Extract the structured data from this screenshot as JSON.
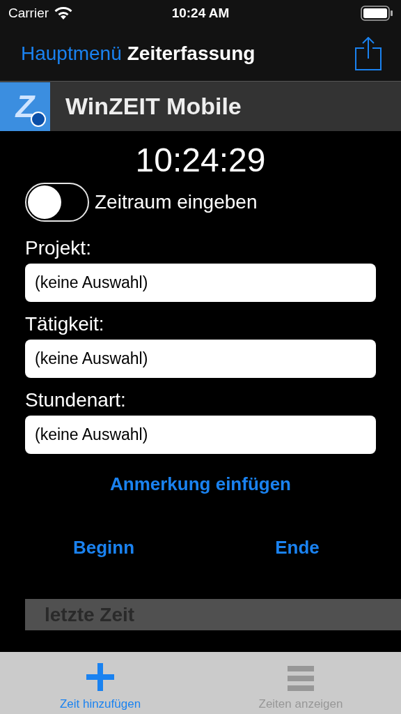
{
  "status_bar": {
    "carrier": "Carrier",
    "time": "10:24 AM"
  },
  "nav": {
    "back": "Hauptmenü",
    "title": "Zeiterfassung"
  },
  "banner": {
    "logo_letter": "Z",
    "title": "WinZEIT Mobile"
  },
  "clock": "10:24:29",
  "period_toggle": {
    "label": "Zeitraum eingeben",
    "on": false
  },
  "fields": [
    {
      "label": "Projekt:",
      "value": "(keine Auswahl)"
    },
    {
      "label": "Tätigkeit:",
      "value": "(keine Auswahl)"
    },
    {
      "label": "Stundenart:",
      "value": "(keine Auswahl)"
    }
  ],
  "note_link": "Anmerkung einfügen",
  "actions": [
    "Beginn",
    "Ende"
  ],
  "last_time": {
    "header": "letzte Zeit"
  },
  "tabs": [
    {
      "label": "Zeit hinzufügen",
      "kind": "add",
      "selected": true
    },
    {
      "label": "Zeiten anzeigen",
      "kind": "list",
      "selected": false
    }
  ]
}
